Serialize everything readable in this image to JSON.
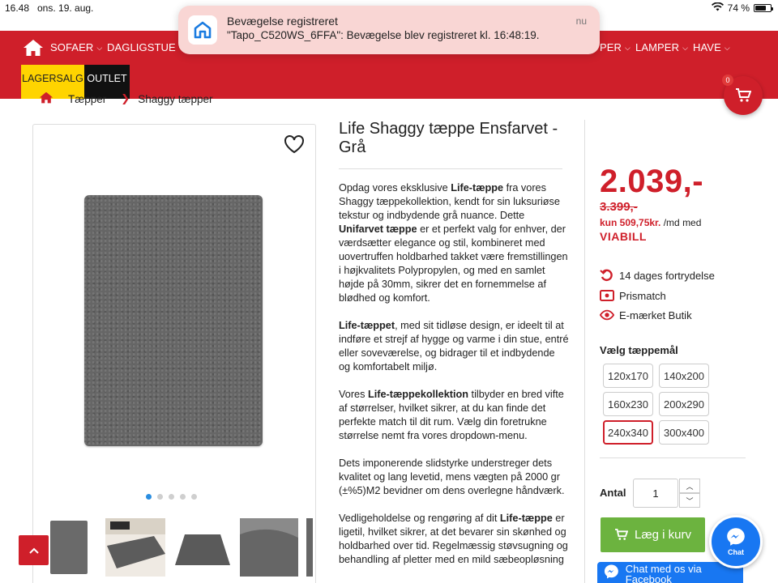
{
  "statusbar": {
    "time": "16.48",
    "date": "ons. 19. aug.",
    "battery": "74 %",
    "battery_level": 0.74
  },
  "notification": {
    "title": "Bevægelse registreret",
    "body": "\"Tapo_C520WS_6FFA\": Bevægelse blev registreret kl. 16:48:19.",
    "time": "nu"
  },
  "nav": {
    "items": [
      {
        "label": "SOFAER"
      },
      {
        "label": "DAGLIGSTUE"
      },
      {
        "label": "PER"
      },
      {
        "label": "LAMPER"
      },
      {
        "label": "HAVE"
      }
    ],
    "lagersalg": "LAGERSALG",
    "outlet": "OUTLET",
    "cart_count": "0"
  },
  "breadcrumb": {
    "items": [
      "Tæpper",
      "Shaggy tæpper"
    ]
  },
  "product": {
    "title": "Life Shaggy tæppe Ensfarvet - Grå",
    "desc": [
      [
        {
          "t": "Opdag vores eksklusive "
        },
        {
          "t": "Life-tæppe",
          "b": true
        },
        {
          "t": " fra vores Shaggy tæppekollektion, kendt for sin luksuriøse tekstur og indbydende grå nuance. Dette "
        },
        {
          "t": "Unifarvet tæppe",
          "b": true
        },
        {
          "t": " er et perfekt valg for enhver, der værdsætter elegance og stil, kombineret med uovertruffen holdbarhed takket være fremstillingen i højkvalitets Polypropylen, og med en samlet højde på 30mm, sikrer det en fornemmelse af blødhed og komfort."
        }
      ],
      [
        {
          "t": "Life-tæppet",
          "b": true
        },
        {
          "t": ", med sit tidløse design, er ideelt til at indføre et strejf af hygge og varme i din stue, entré eller soveværelse, og bidrager til et indbydende og komfortabelt miljø."
        }
      ],
      [
        {
          "t": "Vores "
        },
        {
          "t": "Life-tæppekollektion",
          "b": true
        },
        {
          "t": " tilbyder en bred vifte af størrelser, hvilket sikrer, at du kan finde det perfekte match til dit rum. Vælg din foretrukne størrelse nemt fra vores dropdown-menu."
        }
      ],
      [
        {
          "t": "Dets imponerende slidstyrke understreger dets kvalitet og lang levetid, mens vægten på 2000 gr (±%5)M2 bevidner om dens overlegne håndværk."
        }
      ],
      [
        {
          "t": "Vedligeholdelse og rengøring af dit "
        },
        {
          "t": "Life-tæppe",
          "b": true
        },
        {
          "t": " er ligetil, hvilket sikrer, at det bevarer sin skønhed og holdbarhed over tid. Regelmæssig støvsugning og behandling af pletter med en mild sæbeopløsning"
        }
      ]
    ]
  },
  "pricing": {
    "price": "2.039,-",
    "old_price": "3.399,-",
    "finance_amount": "kun 509,75kr.",
    "finance_text": " /md med",
    "viabill": "VIABILL",
    "usps": [
      "14 dages fortrydelse",
      "Prismatch",
      "E-mærket Butik"
    ],
    "size_label": "Vælg tæppemål",
    "sizes": [
      "120x170",
      "140x200",
      "160x230",
      "200x290",
      "240x340",
      "300x400"
    ],
    "selected_size": "240x340",
    "quantity_label": "Antal",
    "quantity": "1",
    "add_to_cart": "Læg i kurv"
  },
  "chat": {
    "bubble_label": "Chat",
    "facebook_label": "Chat med os via Facebook"
  },
  "carousel": {
    "slides": 5,
    "active": 0
  },
  "colors": {
    "brand_red": "#cf1f2a",
    "add_green": "#6cb33f",
    "lagersalg_yellow": "#ffd400",
    "facebook_blue": "#1877f2"
  }
}
